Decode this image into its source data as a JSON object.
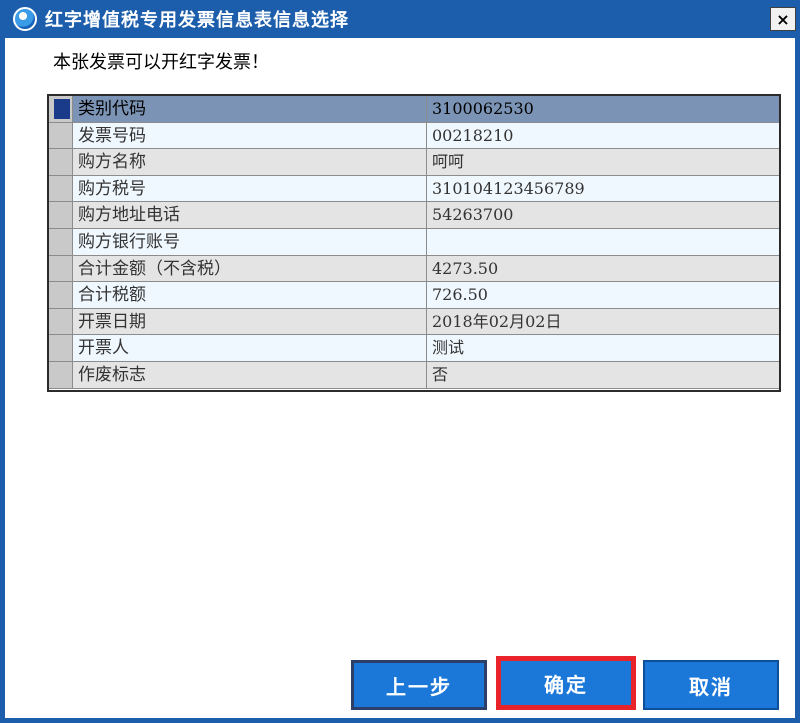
{
  "window": {
    "title": "红字增值税专用发票信息表信息选择",
    "close_label": "×"
  },
  "message": "本张发票可以开红字发票！",
  "grid": {
    "rows": [
      {
        "label": "类别代码",
        "value": "3100062530"
      },
      {
        "label": "发票号码",
        "value": "00218210"
      },
      {
        "label": "购方名称",
        "value": "呵呵"
      },
      {
        "label": "购方税号",
        "value": "310104123456789"
      },
      {
        "label": "购方地址电话",
        "value": "54263700"
      },
      {
        "label": "购方银行账号",
        "value": ""
      },
      {
        "label": "合计金额（不含税）",
        "value": "4273.50"
      },
      {
        "label": "合计税额",
        "value": "726.50"
      },
      {
        "label": "开票日期",
        "value": "2018年02月02日"
      },
      {
        "label": "开票人",
        "value": "测试"
      },
      {
        "label": "作废标志",
        "value": "否"
      }
    ]
  },
  "buttons": {
    "prev": "上一步",
    "ok": "确定",
    "cancel": "取消"
  },
  "colors": {
    "titlebar": "#1c5eab",
    "button": "#1b78d8",
    "highlight_border": "#e8232a",
    "active_row": "#7b93b4"
  }
}
